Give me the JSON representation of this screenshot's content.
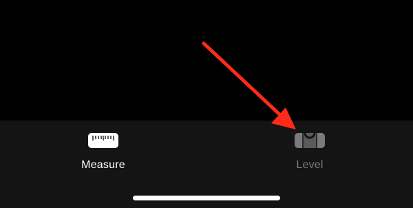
{
  "tabs": [
    {
      "id": "measure",
      "label": "Measure",
      "icon": "ruler-icon",
      "selected": true
    },
    {
      "id": "level",
      "label": "Level",
      "icon": "level-icon",
      "selected": false
    }
  ],
  "colors": {
    "background": "#000000",
    "tabbar": "#141414",
    "active_label": "#ffffff",
    "inactive_label": "#7a7a7a",
    "annotation_arrow": "#ff2a1a"
  }
}
